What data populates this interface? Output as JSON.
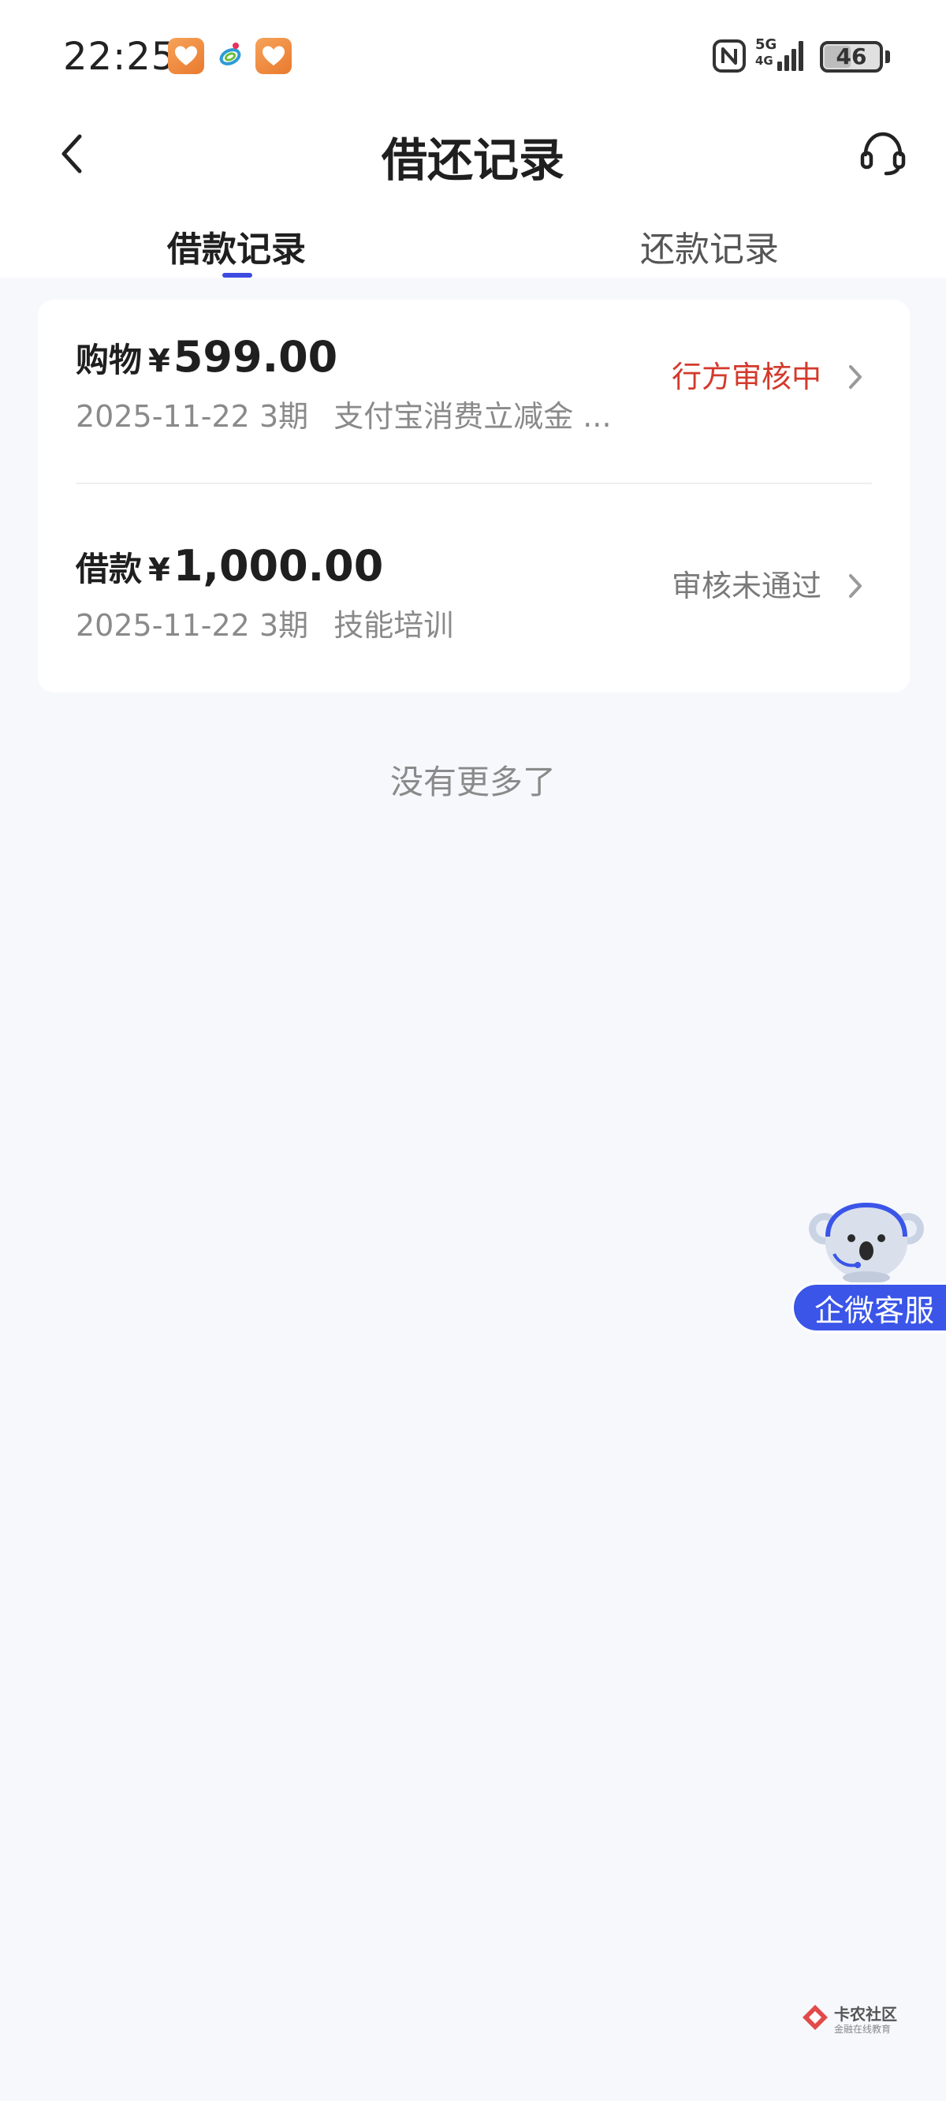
{
  "status_bar": {
    "time": "22:25",
    "network_label": "5G",
    "network_sub": "4G",
    "battery": "46",
    "battery_level": 0.46
  },
  "header": {
    "title": "借还记录",
    "back_icon": "chevron-left-icon",
    "service_icon": "headset-icon"
  },
  "tabs": [
    {
      "label": "借款记录",
      "active": true
    },
    {
      "label": "还款记录",
      "active": false
    }
  ],
  "records": [
    {
      "type": "购物",
      "currency": "¥",
      "amount": "599.00",
      "date": "2025-11-22",
      "periods": "3期",
      "description": "支付宝消费立减金 ...",
      "status": "行方审核中",
      "status_color": "#D33A2C"
    },
    {
      "type": "借款",
      "currency": "¥",
      "amount": "1,000.00",
      "date": "2025-11-22",
      "periods": "3期",
      "description": "技能培训",
      "status": "审核未通过",
      "status_color": "#7A7A7A"
    }
  ],
  "list_footer": "没有更多了",
  "floating_button": {
    "label": "企微客服"
  },
  "watermark": {
    "title": "卡农社区",
    "subtitle": "金融在线教育"
  },
  "colors": {
    "accent": "#3D4BE0",
    "floating_bg": "#3A55E8",
    "page_bg": "#F7F8FC"
  }
}
